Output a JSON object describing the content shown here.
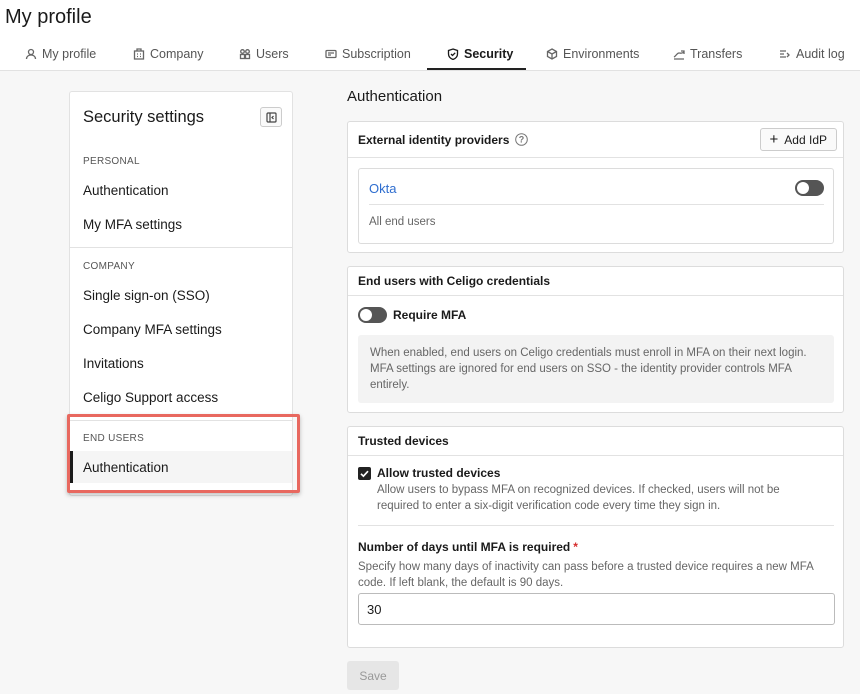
{
  "page": {
    "title": "My profile"
  },
  "tabs": [
    {
      "label": "My profile",
      "icon": "user-icon"
    },
    {
      "label": "Company",
      "icon": "building-icon"
    },
    {
      "label": "Users",
      "icon": "users-icon"
    },
    {
      "label": "Subscription",
      "icon": "card-icon"
    },
    {
      "label": "Security",
      "icon": "shield-icon",
      "active": true
    },
    {
      "label": "Environments",
      "icon": "cube-icon"
    },
    {
      "label": "Transfers",
      "icon": "transfer-icon"
    },
    {
      "label": "Audit log",
      "icon": "list-icon"
    }
  ],
  "sidebar": {
    "title": "Security settings",
    "sections": [
      {
        "label": "PERSONAL",
        "items": [
          "Authentication",
          "My MFA settings"
        ]
      },
      {
        "label": "COMPANY",
        "items": [
          "Single sign-on (SSO)",
          "Company MFA settings",
          "Invitations",
          "Celigo Support access"
        ]
      },
      {
        "label": "END USERS",
        "items": [
          "Authentication"
        ]
      }
    ],
    "active_item": "END USERS / Authentication"
  },
  "main": {
    "title": "Authentication",
    "idp_card": {
      "header": "External identity providers",
      "add_button": "Add IdP",
      "provider_name": "Okta",
      "provider_scope": "All end users",
      "enabled": false
    },
    "celigo_card": {
      "header": "End users with Celigo credentials",
      "require_mfa_label": "Require MFA",
      "require_mfa_enabled": false,
      "info": "When enabled, end users on Celigo credentials must enroll in MFA on their next login. MFA settings are ignored for end users on SSO - the identity provider controls MFA entirely."
    },
    "trusted_card": {
      "header": "Trusted devices",
      "allow_label": "Allow trusted devices",
      "allow_checked": true,
      "allow_desc": "Allow users to bypass MFA on recognized devices. If checked, users will not be required to enter a six-digit verification code every time they sign in.",
      "days_label": "Number of days until MFA is required",
      "days_required_mark": "*",
      "days_desc": "Specify how many days of inactivity can pass before a trusted device requires a new MFA code. If left blank, the default is 90 days.",
      "days_value": "30"
    },
    "save_label": "Save"
  },
  "colors": {
    "link": "#2f6ecf",
    "highlight": "#e8685f",
    "required": "#d62d2d"
  }
}
